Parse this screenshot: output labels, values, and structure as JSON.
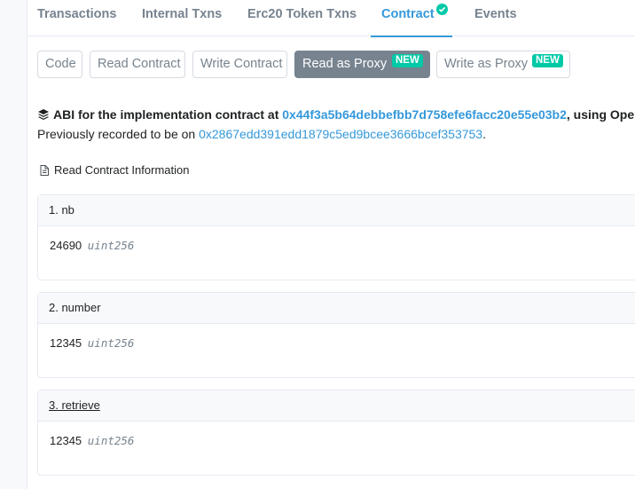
{
  "tabs": [
    {
      "label": "Transactions"
    },
    {
      "label": "Internal Txns"
    },
    {
      "label": "Erc20 Token Txns"
    },
    {
      "label": "Contract",
      "active": true,
      "verified_icon": "check-circle-icon"
    },
    {
      "label": "Events"
    }
  ],
  "sub_buttons": [
    {
      "label": "Code"
    },
    {
      "label": "Read Contract"
    },
    {
      "label": "Write Contract"
    },
    {
      "label": "Read as Proxy",
      "badge": "NEW",
      "active": true
    },
    {
      "label": "Write as Proxy",
      "badge": "NEW"
    }
  ],
  "abi": {
    "prefix": "ABI for the implementation contract at ",
    "address": "0x44f3a5b64debbefbb7d758efe6facc20e55e03b2",
    "suffix": ", using Oper",
    "prev_prefix": "Previously recorded to be on ",
    "prev_address": "0x2867edd391edd1879c5ed9bcee3666bcef353753",
    "prev_suffix": "."
  },
  "read_info_label": "Read Contract Information",
  "functions": [
    {
      "header": "1. nb",
      "value": "24690",
      "type": "uint256"
    },
    {
      "header": "2. number",
      "value": "12345",
      "type": "uint256"
    },
    {
      "header": "3. retrieve",
      "value": "12345",
      "type": "uint256"
    }
  ],
  "colors": {
    "accent": "#3498db",
    "badge": "#00c9a7",
    "muted": "#77838f"
  }
}
